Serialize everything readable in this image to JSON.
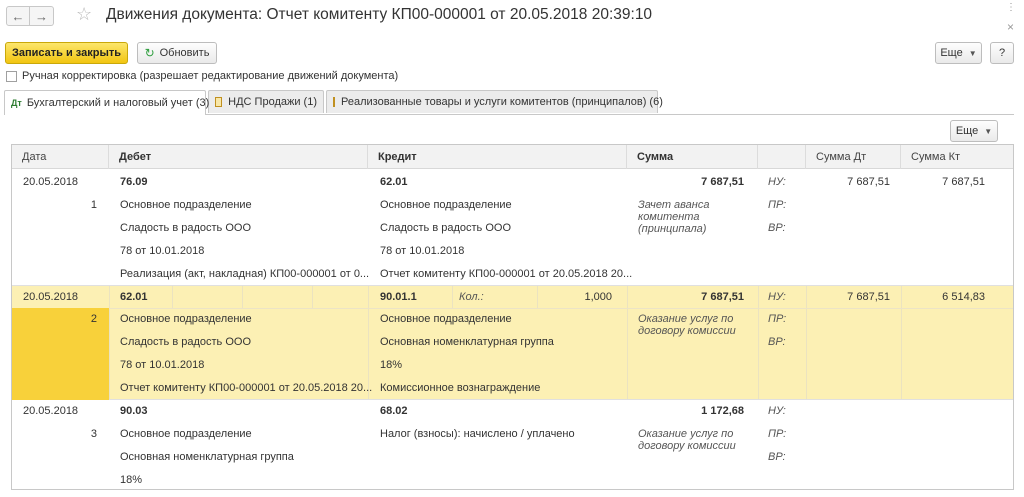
{
  "window": {
    "title": "Движения документа: Отчет комитенту КП00-000001 от 20.05.2018 20:39:10",
    "back": "←",
    "forward": "→",
    "star": "☆",
    "more": "⋮",
    "close": "×"
  },
  "toolbar": {
    "save_close": "Записать и закрыть",
    "refresh": "Обновить",
    "more": "Еще",
    "help": "?"
  },
  "manual_edit": {
    "label": "Ручная корректировка (разрешает редактирование движений документа)",
    "checked": false
  },
  "tabs": [
    {
      "label": "Бухгалтерский и налоговый учет (3)",
      "active": true,
      "icon": "Дт/Кт"
    },
    {
      "label": "НДС Продажи (1)",
      "active": false
    },
    {
      "label": "Реализованные товары и услуги комитентов (принципалов) (6)",
      "active": false
    }
  ],
  "table": {
    "more": "Еще",
    "columns": [
      "Дата",
      "Дебет",
      "Кредит",
      "Сумма",
      "Сумма Дт",
      "Сумма Кт"
    ],
    "rows": [
      {
        "date": "20.05.2018",
        "num": "1",
        "debit": [
          "76.09",
          "Основное подразделение",
          "Сладость в радость ООО",
          "78 от 10.01.2018",
          "Реализация (акт, накладная) КП00-000001 от 0..."
        ],
        "credit": [
          "62.01",
          "Основное подразделение",
          "Сладость в радость ООО",
          "78 от 10.01.2018",
          "Отчет комитенту КП00-000001 от 20.05.2018 20..."
        ],
        "qty_label": "",
        "qty": "",
        "sum": "7 687,51",
        "content": "Зачет аванса комитента (принципала)",
        "nu": "НУ:",
        "pr": "ПР:",
        "vr": "ВР:",
        "sum_dt": "7 687,51",
        "sum_kt": "7 687,51"
      },
      {
        "date": "20.05.2018",
        "num": "2",
        "debit": [
          "62.01",
          "Основное подразделение",
          "Сладость в радость ООО",
          "78 от 10.01.2018",
          "Отчет комитенту КП00-000001 от 20.05.2018 20..."
        ],
        "credit": [
          "90.01.1",
          "Основное подразделение",
          "Основная номенклатурная группа",
          "18%",
          "Комиссионное вознаграждение"
        ],
        "qty_label": "Кол.:",
        "qty": "1,000",
        "sum": "7 687,51",
        "content": "Оказание услуг по договору комиссии",
        "nu": "НУ:",
        "pr": "ПР:",
        "vr": "ВР:",
        "sum_dt": "7 687,51",
        "sum_kt": "6 514,83"
      },
      {
        "date": "20.05.2018",
        "num": "3",
        "debit": [
          "90.03",
          "Основное подразделение",
          "Основная номенклатурная группа",
          "18%"
        ],
        "credit": [
          "68.02",
          "Налог (взносы): начислено / уплачено"
        ],
        "qty_label": "",
        "qty": "",
        "sum": "1 172,68",
        "content": "Оказание услуг по договору комиссии",
        "nu": "НУ:",
        "pr": "ПР:",
        "vr": "ВР:",
        "sum_dt": "",
        "sum_kt": ""
      }
    ]
  }
}
